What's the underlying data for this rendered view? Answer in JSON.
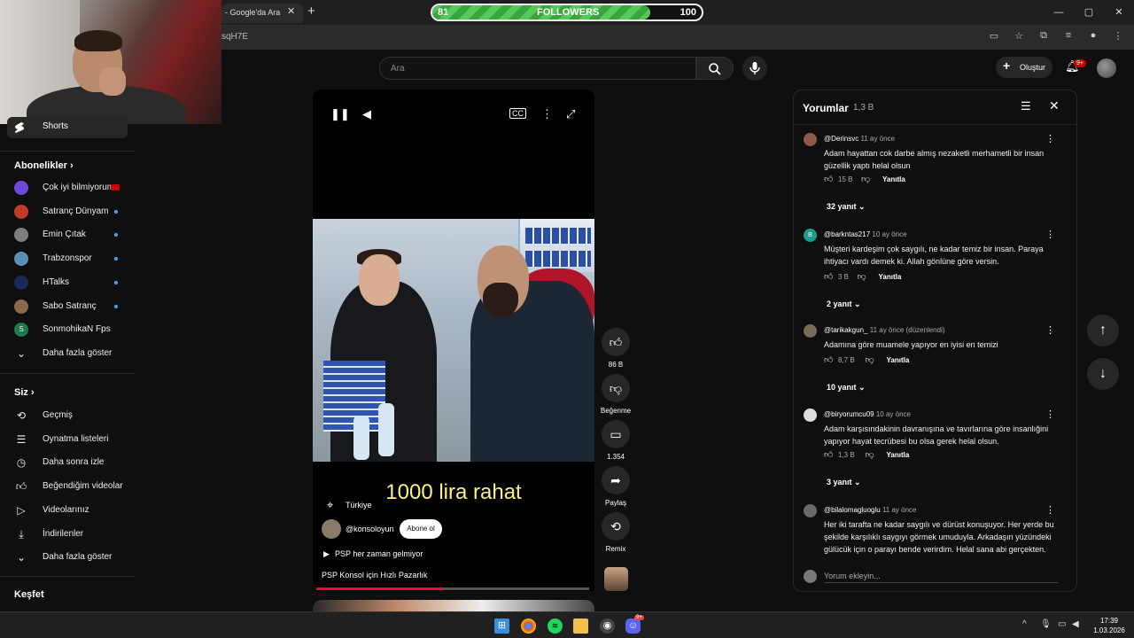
{
  "browser": {
    "tab_title": "- Google'da Ara",
    "tab_close": "✕",
    "new_tab": "+",
    "url": "sqH7E",
    "window_controls": [
      "—",
      "▢",
      "✕"
    ]
  },
  "overlay": {
    "followers_current": "81",
    "followers_label": "FOLLOWERS",
    "followers_goal": "100",
    "followers_progress": 0.81
  },
  "header": {
    "search_placeholder": "Ara",
    "create_label": "Oluştur",
    "create_icon": "+",
    "notification_badge": "9+"
  },
  "sidebar": {
    "shorts_label": "Shorts",
    "subscriptions_title": "Abonelikler",
    "subscriptions": [
      {
        "label": "Çok iyi bilmiyorum",
        "color": "#6b4bd8",
        "marker": "live"
      },
      {
        "label": "Satranç Dünyam",
        "color": "#c0392b",
        "marker": "dot"
      },
      {
        "label": "Emin Çıtak",
        "color": "#7d7d7d",
        "marker": "dot"
      },
      {
        "label": "Trabzonspor",
        "color": "#5a8fb8",
        "marker": "dot"
      },
      {
        "label": "HTalks",
        "color": "#1a2a5a",
        "marker": "dot"
      },
      {
        "label": "Sabo Satranç",
        "color": "#8a6a4a",
        "marker": "dot"
      },
      {
        "label": "SonmohikaN Fps",
        "color": "#1e7a4a",
        "letter": "S",
        "marker": "none"
      }
    ],
    "show_more_1": "Daha fazla göster",
    "you_title": "Siz",
    "you_items": [
      {
        "label": "Geçmiş",
        "icon": "history-icon"
      },
      {
        "label": "Oynatma listeleri",
        "icon": "playlist-icon"
      },
      {
        "label": "Daha sonra izle",
        "icon": "watch-later-icon"
      },
      {
        "label": "Beğendiğim videolar",
        "icon": "liked-icon"
      },
      {
        "label": "Videolarınız",
        "icon": "your-videos-icon"
      },
      {
        "label": "İndirilenler",
        "icon": "download-icon"
      }
    ],
    "show_more_2": "Daha fazla göster",
    "explore_title": "Keşfet"
  },
  "player": {
    "caption": "1000 lira rahat",
    "location": "Türkiye",
    "channel": "@konsoloyun",
    "subscribe_label": "Abone ol",
    "music": "PSP her zaman gelmiyor",
    "title": "PSP Konsol için Hızlı Pazarlık",
    "progress": 0.46
  },
  "actions": {
    "like_count": "86 B",
    "dislike_label": "Beğenme",
    "comment_count": "1.354",
    "share_label": "Paylaş",
    "remix_label": "Remix"
  },
  "comments": {
    "title": "Yorumlar",
    "count": "1,3 B",
    "input_placeholder": "Yorum ekleyin...",
    "reply_label": "Yanıtla",
    "items": [
      {
        "author": "@Derinsvc",
        "time": "11 ay önce",
        "text": "Adam hayattan cok darbe almış nezaketli merhametli bir insan güzellik yaptı helal olsun",
        "likes": "15 B",
        "replies": "32 yanıt",
        "avatar_color": "#8a5a4a"
      },
      {
        "author": "@barkntas217",
        "time": "10 ay önce",
        "text": "Müşteri kardeşim çok saygılı, ne kadar temiz bir insan. Paraya ihtiyacı vardı demek ki. Allah gönlüne göre versin.",
        "likes": "3 B",
        "replies": "2 yanıt",
        "avatar_color": "#1e9e8a",
        "avatar_letter": "B"
      },
      {
        "author": "@tarikakgun_",
        "time": "11 ay önce (düzenlendi)",
        "text": "Adamına göre muamele yapıyor en iyisi en temizi",
        "likes": "8,7 B",
        "replies": "10 yanıt",
        "avatar_color": "#7a6a5a"
      },
      {
        "author": "@biryorumcu09",
        "time": "10 ay önce",
        "text": "Adam karşısındakinin davranışına ve tavırlarına göre insanlığini yapıyor hayat tecrübesi bu olsa gerek helal olsun.",
        "likes": "1,3 B",
        "replies": "3 yanıt",
        "avatar_color": "#dddddd"
      },
      {
        "author": "@bilalomagluoglu",
        "time": "11 ay önce",
        "text": "Her iki tarafta ne kadar saygılı ve dürüst konuşuyor. Her yerde bu şekilde karşılıklı saygıyı görmek umuduyla. Arkadaşın yüzündeki gülücük için o parayı bende verirdim. Helal sana abi gerçekten.",
        "likes": "",
        "replies": "",
        "avatar_color": "#6a6a6a"
      }
    ]
  },
  "taskbar": {
    "time": "17:39",
    "date": "1.03.2026",
    "discord_badge": "9+"
  },
  "colors": {
    "accent": "#ff0033",
    "caption": "#fcf47a",
    "followers_fill": "#55c95a"
  }
}
